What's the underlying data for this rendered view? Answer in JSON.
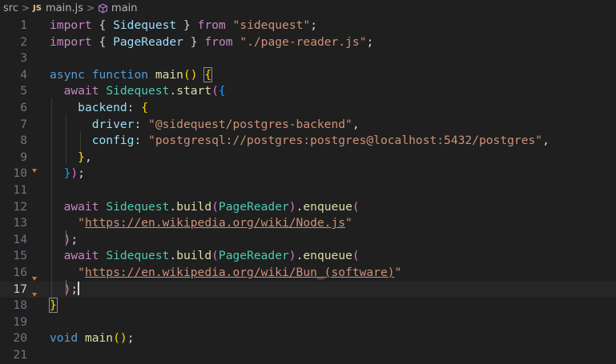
{
  "breadcrumb": {
    "folder": "src",
    "file_badge": "JS",
    "file": "main.js",
    "symbol": "main"
  },
  "editor": {
    "current_line": 17,
    "lines": [
      {
        "n": "1",
        "text": "import { Sidequest } from \"sidequest\";"
      },
      {
        "n": "2",
        "text": "import { PageReader } from \"./page-reader.js\";"
      },
      {
        "n": "3",
        "text": ""
      },
      {
        "n": "4",
        "text": "async function main() {"
      },
      {
        "n": "5",
        "text": "  await Sidequest.start({"
      },
      {
        "n": "6",
        "text": "    backend: {"
      },
      {
        "n": "7",
        "text": "      driver: \"@sidequest/postgres-backend\","
      },
      {
        "n": "8",
        "text": "      config: \"postgresql://postgres:postgres@localhost:5432/postgres\","
      },
      {
        "n": "9",
        "text": "    },"
      },
      {
        "n": "10",
        "text": "  });"
      },
      {
        "n": "11",
        "text": ""
      },
      {
        "n": "12",
        "text": "  await Sidequest.build(PageReader).enqueue("
      },
      {
        "n": "13",
        "text": "    \"https://en.wikipedia.org/wiki/Node.js\""
      },
      {
        "n": "14",
        "text": "  );"
      },
      {
        "n": "15",
        "text": "  await Sidequest.build(PageReader).enqueue("
      },
      {
        "n": "16",
        "text": "    \"https://en.wikipedia.org/wiki/Bun_(software)\""
      },
      {
        "n": "17",
        "text": "  );"
      },
      {
        "n": "18",
        "text": "}"
      },
      {
        "n": "19",
        "text": ""
      },
      {
        "n": "20",
        "text": "void main();"
      },
      {
        "n": "21",
        "text": ""
      }
    ]
  },
  "colors": {
    "background": "#1f1f1f",
    "keyword": "#569cd6",
    "control_keyword": "#c586c0",
    "class": "#4ec9b0",
    "function": "#dcdcaa",
    "property": "#9cdcfe",
    "string": "#ce9178",
    "fold_marker": "#e06c2a"
  }
}
